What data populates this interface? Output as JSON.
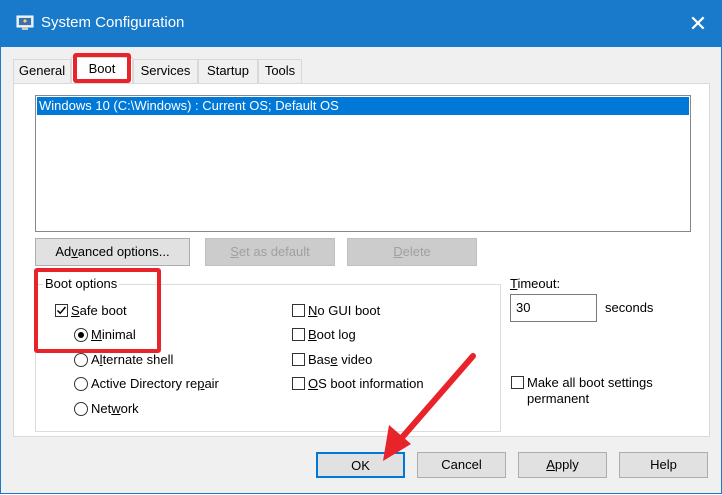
{
  "window": {
    "title": "System Configuration",
    "close_glyph": "✕"
  },
  "tabs": [
    {
      "label": "General"
    },
    {
      "label": "Boot"
    },
    {
      "label": "Services"
    },
    {
      "label": "Startup"
    },
    {
      "label": "Tools"
    }
  ],
  "os_list": {
    "selected": "Windows 10 (C:\\Windows) : Current OS; Default OS"
  },
  "buttons": {
    "advanced_pre": "Ad",
    "advanced_u": "v",
    "advanced_post": "anced options...",
    "set_default_pre": "",
    "set_default_u": "S",
    "set_default_post": "et as default",
    "delete_pre": "",
    "delete_u": "D",
    "delete_post": "elete"
  },
  "boot_options": {
    "label": "Boot options",
    "safe_boot": {
      "pre": "",
      "u": "S",
      "post": "afe boot",
      "checked": true
    },
    "minimal": {
      "pre": "",
      "u": "M",
      "post": "inimal",
      "selected": true
    },
    "alternate_shell": {
      "pre": "A",
      "u": "l",
      "post": "ternate shell"
    },
    "active_directory": {
      "pre": "Active Directory re",
      "u": "p",
      "post": "air"
    },
    "network": {
      "pre": "Net",
      "u": "w",
      "post": "ork"
    },
    "no_gui": {
      "pre": "",
      "u": "N",
      "post": "o GUI boot"
    },
    "boot_log": {
      "pre": "",
      "u": "B",
      "post": "oot log"
    },
    "base_video": {
      "pre": "Bas",
      "u": "e",
      "post": " video"
    },
    "os_boot_info": {
      "pre": "",
      "u": "O",
      "post": "S boot information"
    }
  },
  "timeout": {
    "label_u": "T",
    "label_post": "imeout:",
    "value": "30",
    "unit": "seconds"
  },
  "make_permanent": {
    "line1": "Make all boot settings",
    "line2": "permanent"
  },
  "footer": {
    "ok": "OK",
    "cancel": "Cancel",
    "apply_u": "A",
    "apply_post": "pply",
    "help": "Help"
  },
  "colors": {
    "titlebar": "#1979ca",
    "selection": "#0078d7",
    "annotation": "#e8232a"
  }
}
